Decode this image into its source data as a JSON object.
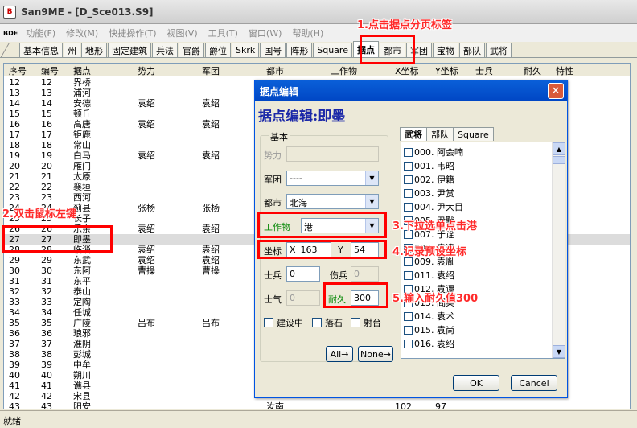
{
  "window": {
    "title": "San9ME - [D_Sce013.S9]",
    "app_icon": "app-icon"
  },
  "menu": {
    "bde": "BDE",
    "items": [
      "功能(F)",
      "修改(M)",
      "快捷操作(T)",
      "视图(V)",
      "工具(T)",
      "窗口(W)",
      "帮助(H)"
    ]
  },
  "tabs": [
    "基本信息",
    "州",
    "地形",
    "固定建筑",
    "兵法",
    "官爵",
    "爵位",
    "Skrk",
    "国号",
    "阵形",
    "Square",
    "据点",
    "都市",
    "军团",
    "宝物",
    "部队",
    "武将"
  ],
  "active_tab": "据点",
  "table": {
    "columns": [
      "序号",
      "编号",
      "据点",
      "势力",
      "军团",
      "都市",
      "工作物",
      "X坐标",
      "Y坐标",
      "士兵",
      "耐久",
      "特性"
    ],
    "rows": [
      [
        "12",
        "12",
        "界桥",
        "",
        "",
        "",
        "",
        "",
        "",
        "",
        "",
        ""
      ],
      [
        "13",
        "13",
        "浦河",
        "",
        "",
        "",
        "",
        "",
        "",
        "",
        "",
        ""
      ],
      [
        "14",
        "14",
        "安德",
        "袁绍",
        "袁绍",
        "",
        "",
        "",
        "",
        "",
        "",
        ""
      ],
      [
        "15",
        "15",
        "顿丘",
        "",
        "",
        "",
        "",
        "",
        "",
        "",
        "",
        ""
      ],
      [
        "16",
        "16",
        "高唐",
        "袁绍",
        "袁绍",
        "",
        "",
        "",
        "",
        "",
        "",
        ""
      ],
      [
        "17",
        "17",
        "钜鹿",
        "",
        "",
        "",
        "",
        "",
        "",
        "",
        "",
        ""
      ],
      [
        "18",
        "18",
        "常山",
        "",
        "",
        "",
        "",
        "",
        "",
        "",
        "",
        ""
      ],
      [
        "19",
        "19",
        "白马",
        "袁绍",
        "袁绍",
        "",
        "",
        "",
        "",
        "",
        "",
        ""
      ],
      [
        "20",
        "20",
        "雁门",
        "",
        "",
        "",
        "",
        "",
        "",
        "",
        "",
        ""
      ],
      [
        "21",
        "21",
        "太原",
        "",
        "",
        "",
        "",
        "",
        "",
        "",
        "",
        ""
      ],
      [
        "22",
        "22",
        "襄垣",
        "",
        "",
        "",
        "",
        "",
        "",
        "",
        "",
        ""
      ],
      [
        "23",
        "23",
        "西河",
        "",
        "",
        "",
        "",
        "",
        "",
        "",
        "",
        ""
      ],
      [
        "24",
        "24",
        "蓟县",
        "张杨",
        "张杨",
        "",
        "",
        "",
        "",
        "",
        "",
        "石"
      ],
      [
        "25",
        "25",
        "长子",
        "",
        "",
        "",
        "",
        "",
        "",
        "",
        "",
        ""
      ],
      [
        "26",
        "26",
        "乐亲",
        "袁绍",
        "袁绍",
        "",
        "",
        "",
        "",
        "",
        "",
        ""
      ],
      [
        "27",
        "27",
        "即墨",
        "",
        "",
        "",
        "",
        "",
        "",
        "",
        "",
        ""
      ],
      [
        "28",
        "28",
        "临淄",
        "袁绍",
        "袁绍",
        "",
        "",
        "",
        "",
        "",
        "",
        ""
      ],
      [
        "29",
        "29",
        "东武",
        "袁绍",
        "袁绍",
        "",
        "",
        "",
        "",
        "",
        "",
        ""
      ],
      [
        "30",
        "30",
        "东阿",
        "曹操",
        "曹操",
        "",
        "",
        "",
        "",
        "",
        "",
        ""
      ],
      [
        "31",
        "31",
        "东平",
        "",
        "",
        "",
        "",
        "",
        "",
        "",
        "",
        ""
      ],
      [
        "32",
        "32",
        "泰山",
        "",
        "",
        "",
        "",
        "",
        "",
        "",
        "",
        ""
      ],
      [
        "33",
        "33",
        "定陶",
        "",
        "",
        "",
        "",
        "",
        "",
        "",
        "",
        ""
      ],
      [
        "34",
        "34",
        "任城",
        "",
        "",
        "",
        "",
        "",
        "",
        "",
        "",
        ""
      ],
      [
        "35",
        "35",
        "广陵",
        "吕布",
        "吕布",
        "",
        "",
        "",
        "",
        "",
        "",
        ""
      ],
      [
        "36",
        "36",
        "琅邪",
        "",
        "",
        "",
        "",
        "",
        "",
        "",
        "",
        ""
      ],
      [
        "37",
        "37",
        "淮阴",
        "",
        "",
        "",
        "",
        "",
        "",
        "",
        "",
        ""
      ],
      [
        "38",
        "38",
        "彭城",
        "",
        "",
        "",
        "",
        "",
        "",
        "",
        "",
        ""
      ],
      [
        "39",
        "39",
        "中牟",
        "",
        "",
        "",
        "",
        "",
        "",
        "",
        "",
        ""
      ],
      [
        "40",
        "40",
        "朔川",
        "",
        "",
        "",
        "",
        "",
        "",
        "",
        "",
        ""
      ],
      [
        "41",
        "41",
        "谯县",
        "",
        "",
        "",
        "",
        "",
        "",
        "",
        "",
        ""
      ],
      [
        "42",
        "42",
        "宋县",
        "",
        "",
        "",
        "",
        "",
        "",
        "",
        "",
        ""
      ],
      [
        "43",
        "43",
        "阳安",
        "",
        "",
        "汝南",
        "",
        "102",
        "97",
        "",
        "",
        ""
      ]
    ],
    "selected_row": 15
  },
  "status": "就绪",
  "dialog": {
    "title": "据点编辑",
    "heading": "据点编辑:即墨",
    "group_label": "基本",
    "force_label": "势力",
    "force_value": "",
    "corps_label": "军团",
    "corps_value": "----",
    "city_label": "都市",
    "city_value": "北海",
    "work_label": "工作物",
    "work_value": "港",
    "coord_label": "坐标",
    "x_label": "X",
    "x_value": "163",
    "y_label": "Y",
    "y_value": "54",
    "soldier_label": "士兵",
    "soldier_value": "0",
    "wounded_label": "伤兵",
    "wounded_value": "0",
    "morale_label": "士气",
    "morale_value": "0",
    "durability_label": "耐久",
    "durability_value": "300",
    "checks": [
      "建设中",
      "落石",
      "射台"
    ],
    "all_btn": "All→",
    "none_btn": "None→",
    "ok_btn": "OK",
    "cancel_btn": "Cancel",
    "right_tabs": [
      "武将",
      "部队",
      "Square"
    ],
    "officers": [
      "000. 阿会喃",
      "001. 韦昭",
      "002. 伊籍",
      "003. 尹赏",
      "004. 尹大目",
      "005. 尹默",
      "007. 于诠",
      "008. 袁遗",
      "009. 袁胤",
      "011. 袁绍",
      "012. 袁谭",
      "013. 阎柔",
      "014. 袁术",
      "015. 袁尚",
      "016. 袁绍"
    ]
  },
  "annotations": {
    "a1": "1.点击据点分页标签",
    "a2": "2.双击鼠标左键",
    "a3": "3.下拉选单点击港",
    "a4": "4.记录预设坐标",
    "a5": "5.输入耐久值300"
  },
  "colors": {
    "accent_red": "#ff0000",
    "title_blue": "#0046c4",
    "heading_blue": "#1a27a8"
  }
}
